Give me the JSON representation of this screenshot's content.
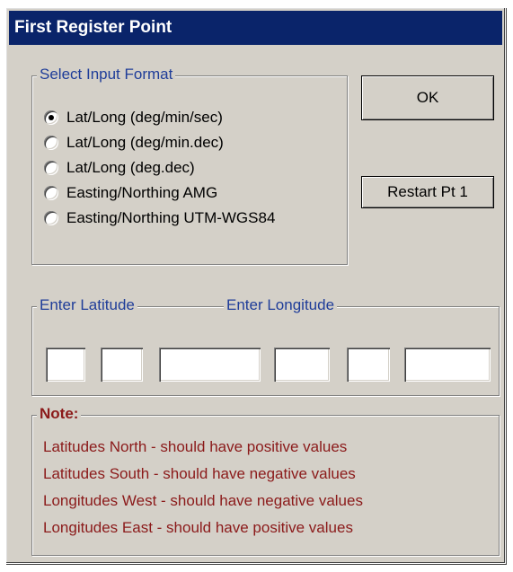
{
  "window": {
    "title": "First Register Point"
  },
  "input_format": {
    "legend": "Select Input Format",
    "options": [
      {
        "label": "Lat/Long (deg/min/sec)",
        "checked": true
      },
      {
        "label": "Lat/Long (deg/min.dec)",
        "checked": false
      },
      {
        "label": "Lat/Long (deg.dec)",
        "checked": false
      },
      {
        "label": "Easting/Northing AMG",
        "checked": false
      },
      {
        "label": "Easting/Northing UTM-WGS84",
        "checked": false
      }
    ]
  },
  "buttons": {
    "ok": "OK",
    "restart": "Restart Pt 1"
  },
  "coordinates": {
    "latitude_label": "Enter Latitude",
    "longitude_label": "Enter Longitude",
    "latitude_fields": [
      "",
      "",
      ""
    ],
    "longitude_fields": [
      "",
      "",
      ""
    ]
  },
  "note": {
    "legend": "Note:",
    "lines": [
      "Latitudes North - should have positive values",
      "Latitudes South - should have negative values",
      "Longitudes West - should have negative values",
      "Longitudes East - should have positive values"
    ]
  },
  "colors": {
    "title_bar": "#0a246a",
    "group_label": "#1f3d99",
    "note_text": "#8b1a1a",
    "dialog_face": "#d4d0c8"
  }
}
